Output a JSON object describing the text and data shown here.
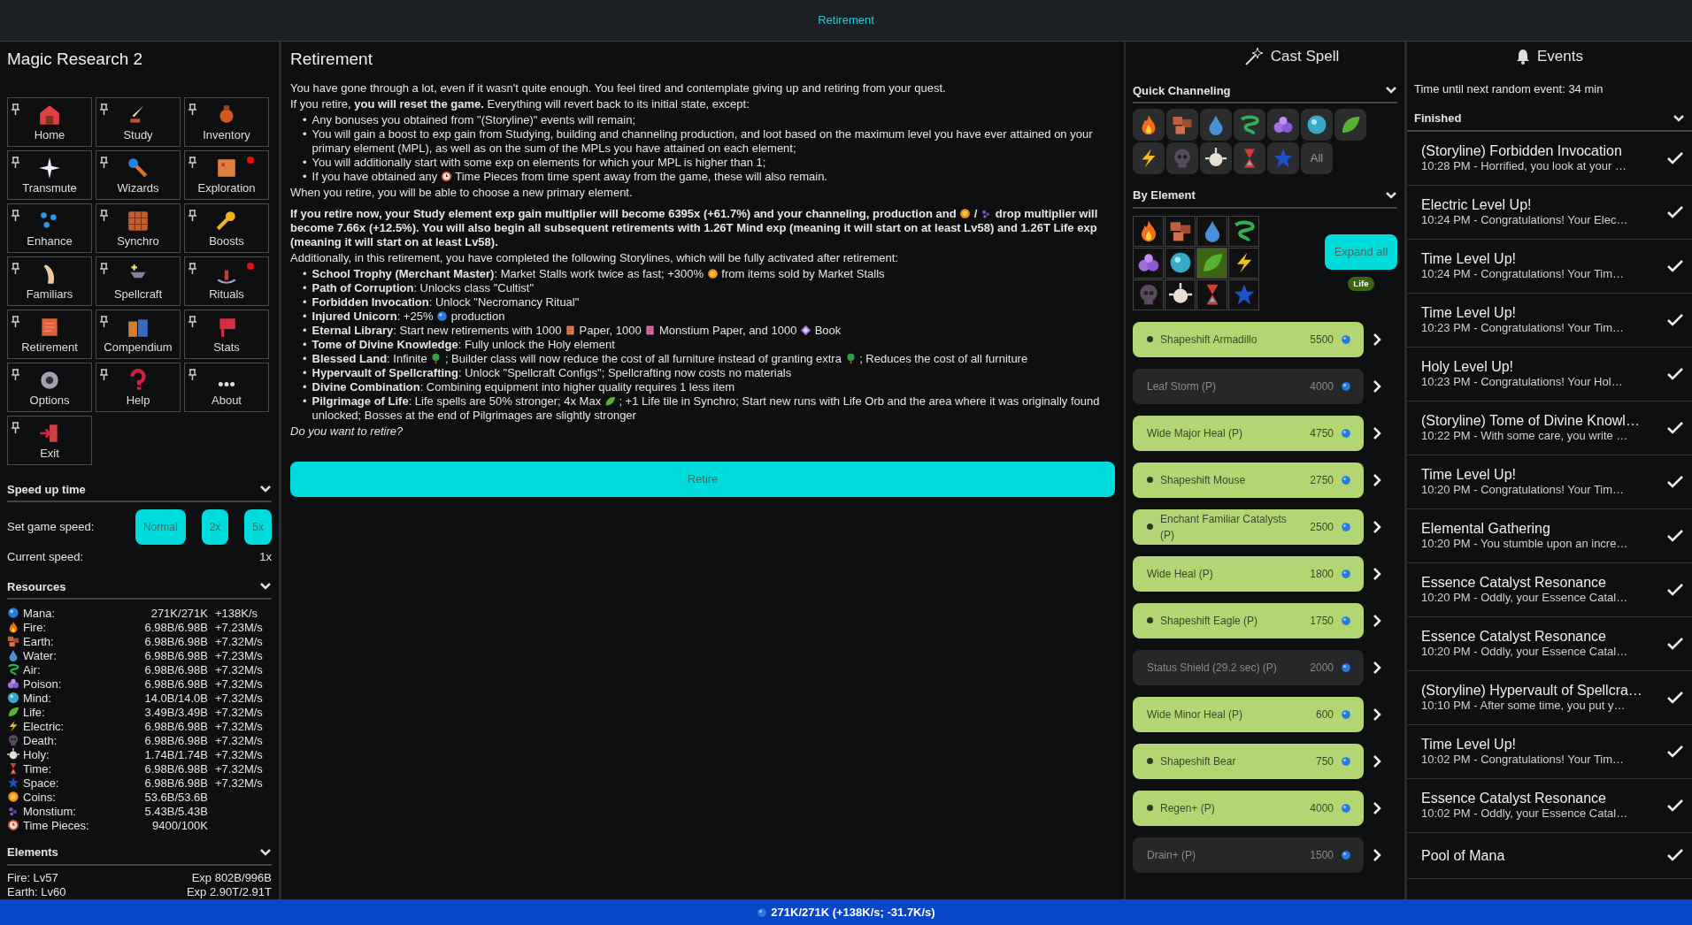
{
  "top_bar": {
    "title": "Retirement"
  },
  "sidebar": {
    "title": "Magic Research 2",
    "tiles": [
      {
        "label": "Home",
        "notification": false
      },
      {
        "label": "Study",
        "notification": false
      },
      {
        "label": "Inventory",
        "notification": false
      },
      {
        "label": "Transmute",
        "notification": false
      },
      {
        "label": "Wizards",
        "notification": false
      },
      {
        "label": "Exploration",
        "notification": true
      },
      {
        "label": "Enhance",
        "notification": false
      },
      {
        "label": "Synchro",
        "notification": false
      },
      {
        "label": "Boosts",
        "notification": false
      },
      {
        "label": "Familiars",
        "notification": false
      },
      {
        "label": "Spellcraft",
        "notification": false
      },
      {
        "label": "Rituals",
        "notification": true
      },
      {
        "label": "Retirement",
        "notification": false
      },
      {
        "label": "Compendium",
        "notification": false
      },
      {
        "label": "Stats",
        "notification": false
      },
      {
        "label": "Options",
        "notification": false
      },
      {
        "label": "Help",
        "notification": false
      },
      {
        "label": "About",
        "notification": false
      },
      {
        "label": "Exit",
        "notification": false
      }
    ],
    "speed": {
      "title": "Speed up time",
      "label": "Set game speed:",
      "buttons": [
        "Normal",
        "2x",
        "5x"
      ],
      "current_label": "Current speed:",
      "current_value": "1x"
    },
    "resources": {
      "title": "Resources",
      "rows": [
        {
          "name": "Mana:",
          "amount": "271K/271K",
          "rate": "+138K/s"
        },
        {
          "name": "Fire:",
          "amount": "6.98B/6.98B",
          "rate": "+7.23M/s"
        },
        {
          "name": "Earth:",
          "amount": "6.98B/6.98B",
          "rate": "+7.32M/s"
        },
        {
          "name": "Water:",
          "amount": "6.98B/6.98B",
          "rate": "+7.23M/s"
        },
        {
          "name": "Air:",
          "amount": "6.98B/6.98B",
          "rate": "+7.32M/s"
        },
        {
          "name": "Poison:",
          "amount": "6.98B/6.98B",
          "rate": "+7.32M/s"
        },
        {
          "name": "Mind:",
          "amount": "14.0B/14.0B",
          "rate": "+7.32M/s"
        },
        {
          "name": "Life:",
          "amount": "3.49B/3.49B",
          "rate": "+7.32M/s"
        },
        {
          "name": "Electric:",
          "amount": "6.98B/6.98B",
          "rate": "+7.32M/s"
        },
        {
          "name": "Death:",
          "amount": "6.98B/6.98B",
          "rate": "+7.32M/s"
        },
        {
          "name": "Holy:",
          "amount": "1.74B/1.74B",
          "rate": "+7.32M/s"
        },
        {
          "name": "Time:",
          "amount": "6.98B/6.98B",
          "rate": "+7.32M/s"
        },
        {
          "name": "Space:",
          "amount": "6.98B/6.98B",
          "rate": "+7.32M/s"
        },
        {
          "name": "Coins:",
          "amount": "53.6B/53.6B"
        },
        {
          "name": "Monstium:",
          "amount": "5.43B/5.43B"
        },
        {
          "name": "Time Pieces:",
          "amount": "9400/100K"
        }
      ]
    },
    "elements": {
      "title": "Elements",
      "rows": [
        {
          "name": "Fire: Lv57",
          "exp": "Exp 802B/996B"
        },
        {
          "name": "Earth: Lv60",
          "exp": "Exp 2.90T/2.91T"
        }
      ]
    }
  },
  "retirement": {
    "title": "Retirement",
    "intro": "You have gone through a lot, even if it wasn't quite enough. You feel tired and contemplate giving up and retiring from your quest.",
    "reset": "If you retire, **you will reset the game.** Everything will revert back to its initial state, except:",
    "keeps": [
      {
        "parts": [
          "Any bonuses you obtained from \"(Storyline)\" events will remain;"
        ]
      },
      {
        "parts": [
          "You will gain a boost to exp gain from Studying, building and channeling production, and loot based on the maximum level you have ever attained on your primary element (MPL), as well as on the sum of the MPLs you have attained on each element;"
        ]
      },
      {
        "parts": [
          "You will additionally start with some exp on elements for which your MPL is higher than 1;"
        ]
      },
      {
        "parts": [
          "If you have obtained any",
          "Time Pieces from time spent away from the game, these will also remain."
        ]
      }
    ],
    "marker": "•",
    "choose": "When you retire, you will be able to choose a new primary element.",
    "summary": {
      "parts": [
        "If you retire now, your Study element exp gain multiplier will become 6395x (+61.7%) and your channeling, production and",
        "/",
        "drop multiplier will become 7.66x (+12.5%). You will also begin all subsequent retirements with 1.26T Mind exp (meaning it will start on at least Lv58) and 1.26T Life exp (meaning it will start on at least Lv58)."
      ]
    },
    "storylines_intro": "Additionally, in this retirement, you have completed the following Storylines, which will be fully activated after retirement:",
    "storylines": [
      {
        "parts": [
          "**School Trophy (Merchant Master)**: Market Stalls work twice as fast; +300%",
          "from items sold by Market Stalls"
        ]
      },
      {
        "parts": [
          "**Path of Corruption**: Unlocks class \"Cultist\""
        ]
      },
      {
        "parts": [
          "**Forbidden Invocation**: Unlock \"Necromancy Ritual\""
        ]
      },
      {
        "parts": [
          "**Injured Unicorn**: +25%",
          "production"
        ]
      },
      {
        "parts": [
          "**Eternal Library**: Start new retirements with 1000",
          "Paper, 1000",
          "Monstium Paper, and 1000",
          "Book"
        ]
      },
      {
        "parts": [
          "**Tome of Divine Knowledge**: Fully unlock the Holy element"
        ]
      },
      {
        "parts": [
          "**Blessed Land**: Infinite",
          "; Builder class will now reduce the cost of all furniture instead of granting extra",
          "; Reduces the cost of all furniture"
        ]
      },
      {
        "parts": [
          "**Hypervault of Spellcrafting**: Unlock \"Spellcraft Configs\"; Spellcrafting now costs no materials"
        ]
      },
      {
        "parts": [
          "**Divine Combination**: Combining equipment into higher quality requires 1 less item"
        ]
      },
      {
        "parts": [
          "**Pilgrimage of Life**: Life spells are 50% stronger; 4x Max",
          "; +1 Life tile in Synchro; Start new runs with Life Orb and the area where it was originally found unlocked; Bosses at the end of Pilgrimages are slightly stronger"
        ]
      }
    ],
    "question": "Do you want to retire?",
    "button": "Retire"
  },
  "cast_spell": {
    "title": "Cast Spell",
    "quick_channeling": {
      "title": "Quick Channeling",
      "all_label": "All"
    },
    "by_element": {
      "title": "By Element",
      "elements": [
        {
          "selected": false
        },
        {
          "selected": false
        },
        {
          "selected": false
        },
        {
          "selected": false
        },
        {
          "selected": false
        },
        {
          "selected": false
        },
        {
          "selected": true
        },
        {
          "selected": false
        },
        {
          "selected": false
        },
        {
          "selected": false
        },
        {
          "selected": false
        },
        {
          "selected": false
        }
      ],
      "expand_button": "Expand all",
      "badge": "Life"
    },
    "spells": [
      {
        "name": "Shapeshift Armadillo",
        "cost": "5500",
        "enabled": true,
        "bullet": true
      },
      {
        "name": "Leaf Storm (P)",
        "cost": "4000",
        "enabled": false,
        "bullet": false
      },
      {
        "name": "Wide Major Heal (P)",
        "cost": "4750",
        "enabled": true,
        "bullet": false
      },
      {
        "name": "Shapeshift Mouse",
        "cost": "2750",
        "enabled": true,
        "bullet": true
      },
      {
        "name": "Enchant Familiar Catalysts (P)",
        "cost": "2500",
        "enabled": true,
        "bullet": true
      },
      {
        "name": "Wide Heal (P)",
        "cost": "1800",
        "enabled": true,
        "bullet": false
      },
      {
        "name": "Shapeshift Eagle (P)",
        "cost": "1750",
        "enabled": true,
        "bullet": true
      },
      {
        "name": "Status Shield (29.2 sec) (P)",
        "cost": "2000",
        "enabled": false,
        "bullet": false
      },
      {
        "name": "Wide Minor Heal (P)",
        "cost": "600",
        "enabled": true,
        "bullet": false
      },
      {
        "name": "Shapeshift Bear",
        "cost": "750",
        "enabled": true,
        "bullet": true
      },
      {
        "name": "Regen+ (P)",
        "cost": "4000",
        "enabled": true,
        "bullet": true
      },
      {
        "name": "Drain+ (P)",
        "cost": "1500",
        "enabled": false,
        "bullet": false
      }
    ]
  },
  "events": {
    "title": "Events",
    "next_event": "Time until next random event: 34 min",
    "section": "Finished",
    "items": [
      {
        "title": "(Storyline) Forbidden Invocation",
        "detail": "10:28 PM - Horrified, you look at your …"
      },
      {
        "title": "Electric Level Up!",
        "detail": "10:24 PM - Congratulations! Your Elec…"
      },
      {
        "title": "Time Level Up!",
        "detail": "10:24 PM - Congratulations! Your Tim…"
      },
      {
        "title": "Time Level Up!",
        "detail": "10:23 PM - Congratulations! Your Tim…"
      },
      {
        "title": "Holy Level Up!",
        "detail": "10:23 PM - Congratulations! Your Hol…"
      },
      {
        "title": "(Storyline) Tome of Divine Knowl…",
        "detail": "10:22 PM - With some care, you write …"
      },
      {
        "title": "Time Level Up!",
        "detail": "10:20 PM - Congratulations! Your Tim…"
      },
      {
        "title": "Elemental Gathering",
        "detail": "10:20 PM - You stumble upon an incre…"
      },
      {
        "title": "Essence Catalyst Resonance",
        "detail": "10:20 PM - Oddly, your Essence Catal…"
      },
      {
        "title": "Essence Catalyst Resonance",
        "detail": "10:20 PM - Oddly, your Essence Catal…"
      },
      {
        "title": "(Storyline) Hypervault of Spellcra…",
        "detail": "10:10 PM - After some time, you put y…"
      },
      {
        "title": "Time Level Up!",
        "detail": "10:02 PM - Congratulations! Your Tim…"
      },
      {
        "title": "Essence Catalyst Resonance",
        "detail": "10:02 PM - Oddly, your Essence Catal…"
      },
      {
        "title": "Pool of Mana"
      }
    ]
  },
  "status_bar": {
    "text": "271K/271K (+138K/s; -31.7K/s)"
  }
}
